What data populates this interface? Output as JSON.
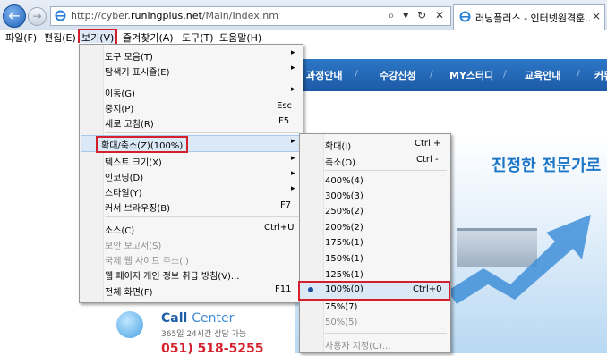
{
  "browser": {
    "url_prefix": "http://cyber.",
    "url_domain": "runingplus.net",
    "url_path": "/Main/Index.nm",
    "addr_tools": "⌕ ▾ ↻ ✕",
    "tab_title": "러닝플러스 - 인터넷원격훈...",
    "tab_close": "×"
  },
  "menubar": [
    "파일(F)",
    "편집(E)",
    "보기(V)",
    "즐겨찾기(A)",
    "도구(T)",
    "도움말(H)"
  ],
  "view_menu": [
    {
      "label": "도구 모음(T)",
      "shortcut": "",
      "arrow": "▸"
    },
    {
      "label": "탐색기 표시줄(E)",
      "shortcut": "",
      "arrow": "▸"
    },
    {
      "label": "이동(G)",
      "shortcut": "",
      "arrow": "▸"
    },
    {
      "label": "중지(P)",
      "shortcut": "Esc",
      "arrow": ""
    },
    {
      "label": "새로 고침(R)",
      "shortcut": "F5",
      "arrow": ""
    },
    {
      "label": "확대/축소(Z)(100%)",
      "shortcut": "",
      "arrow": "▸"
    },
    {
      "label": "텍스트 크기(X)",
      "shortcut": "",
      "arrow": "▸"
    },
    {
      "label": "인코딩(D)",
      "shortcut": "",
      "arrow": "▸"
    },
    {
      "label": "스타일(Y)",
      "shortcut": "",
      "arrow": "▸"
    },
    {
      "label": "커서 브라우징(B)",
      "shortcut": "F7",
      "arrow": ""
    },
    {
      "label": "소스(C)",
      "shortcut": "Ctrl+U",
      "arrow": ""
    },
    {
      "label": "보안 보고서(S)",
      "shortcut": "",
      "arrow": ""
    },
    {
      "label": "국제 웹 사이트 주소(I)",
      "shortcut": "",
      "arrow": ""
    },
    {
      "label": "웹 페이지 개인 정보 취급 방침(V)...",
      "shortcut": "",
      "arrow": ""
    },
    {
      "label": "전체 화면(F)",
      "shortcut": "F11",
      "arrow": ""
    }
  ],
  "zoom_menu": [
    {
      "label": "확대(I)",
      "shortcut": "Ctrl +"
    },
    {
      "label": "축소(O)",
      "shortcut": "Ctrl -"
    },
    {
      "label": "400%(4)",
      "shortcut": ""
    },
    {
      "label": "300%(3)",
      "shortcut": ""
    },
    {
      "label": "250%(2)",
      "shortcut": ""
    },
    {
      "label": "200%(2)",
      "shortcut": ""
    },
    {
      "label": "175%(1)",
      "shortcut": ""
    },
    {
      "label": "150%(1)",
      "shortcut": ""
    },
    {
      "label": "125%(1)",
      "shortcut": ""
    },
    {
      "label": "100%(0)",
      "shortcut": "Ctrl+0"
    },
    {
      "label": "75%(7)",
      "shortcut": ""
    },
    {
      "label": "50%(5)",
      "shortcut": ""
    },
    {
      "label": "사용자 지정(C)...",
      "shortcut": ""
    }
  ],
  "site": {
    "nav": [
      "과정안내",
      "수강신청",
      "MY스터디",
      "교육안내",
      "커뮤"
    ],
    "nav_sep": "/",
    "hero_text": "진정한 전문가로",
    "cc_title_1": "Call",
    "cc_title_2": "Center",
    "cc_sub": "365일 24시간 상담 가능",
    "cc_phone": "051) 518-5255"
  },
  "colors": {
    "highlight_box": "#d4202c",
    "menu_hover": "#dbe8f6"
  }
}
